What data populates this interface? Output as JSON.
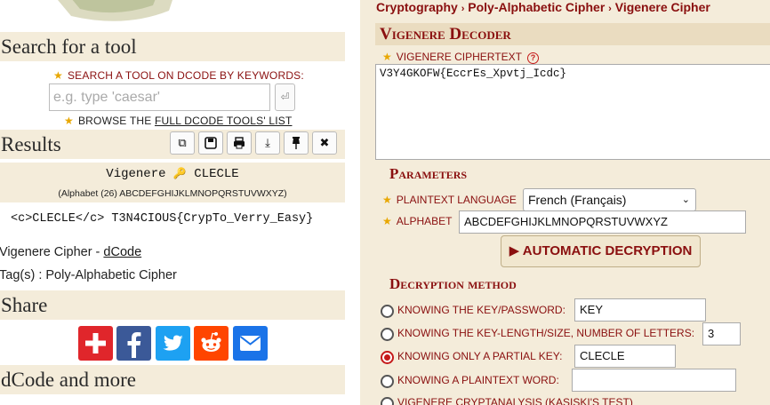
{
  "left": {
    "search_section": {
      "heading": "Search for a tool",
      "keywords_label": "SEARCH A TOOL ON DCODE BY KEYWORDS:",
      "placeholder": "e.g. type 'caesar'",
      "go_symbol": "⏎",
      "browse_prefix": "BROWSE THE",
      "browse_link": "FULL DCODE TOOLS' LIST"
    },
    "results_section": {
      "heading": "Results",
      "toolbar": [
        "copy-icon",
        "save-icon",
        "print-icon",
        "download-icon",
        "pin-icon",
        "close-icon"
      ],
      "cipher_name": "Vigenere",
      "key_icon": "🔑",
      "key_value": "CLECLE",
      "alphabet_note": "(Alphabet (26) ABCDEFGHIJKLMNOPQRSTUVWXYZ)",
      "output_line": "<c>CLECLE</c> T3N4CIOUS{CrypTo_Verry_Easy}",
      "source_prefix": "Vigenere Cipher - ",
      "source_link": "dCode",
      "tags": "Tag(s) : Poly-Alphabetic Cipher"
    },
    "share_section": {
      "heading": "Share",
      "buttons": [
        {
          "name": "addthis",
          "color": "#e0262b",
          "glyph": "+"
        },
        {
          "name": "facebook",
          "color": "#3b5998",
          "glyph": "f"
        },
        {
          "name": "twitter",
          "color": "#1da1f2",
          "glyph": "🐦"
        },
        {
          "name": "reddit",
          "color": "#ff4500",
          "glyph": "👽"
        },
        {
          "name": "email",
          "color": "#1a73e8",
          "glyph": "✉"
        }
      ]
    },
    "more_section": {
      "heading": "dCode and more"
    }
  },
  "right": {
    "breadcrumb": [
      "Cryptography",
      "Poly-Alphabetic Cipher",
      "Vigenere Cipher"
    ],
    "breadcrumb_sep": "›",
    "title": "Vigenere Decoder",
    "ciphertext_label": "VIGENERE CIPHERTEXT",
    "ciphertext_value": "V3Y4GKOFW{EccrEs_Xpvtj_Icdc}",
    "parameters_heading": "Parameters",
    "language_label": "PLAINTEXT LANGUAGE",
    "language_value": "French (Français)",
    "alphabet_label": "ALPHABET",
    "alphabet_value": "ABCDEFGHIJKLMNOPQRSTUVWXYZ",
    "auto_button": "▶ AUTOMATIC DECRYPTION",
    "method_heading": "Decryption method",
    "methods": [
      {
        "label": "KNOWING THE KEY/PASSWORD:",
        "value": "KEY",
        "selected": false
      },
      {
        "label": "KNOWING THE KEY-LENGTH/SIZE, NUMBER OF LETTERS:",
        "value": "3",
        "selected": false
      },
      {
        "label": "KNOWING ONLY A PARTIAL KEY:",
        "value": "CLECLE",
        "selected": true
      },
      {
        "label": "KNOWING A PLAINTEXT WORD:",
        "value": "",
        "selected": false
      },
      {
        "label": "VIGENERE CRYPTANALYSIS (KASISKI'S TEST)",
        "value": "",
        "selected": false
      }
    ]
  },
  "colors": {
    "accent": "#8a0f0f",
    "panel_bg": "#f4ecda",
    "star": "#e8a700"
  }
}
